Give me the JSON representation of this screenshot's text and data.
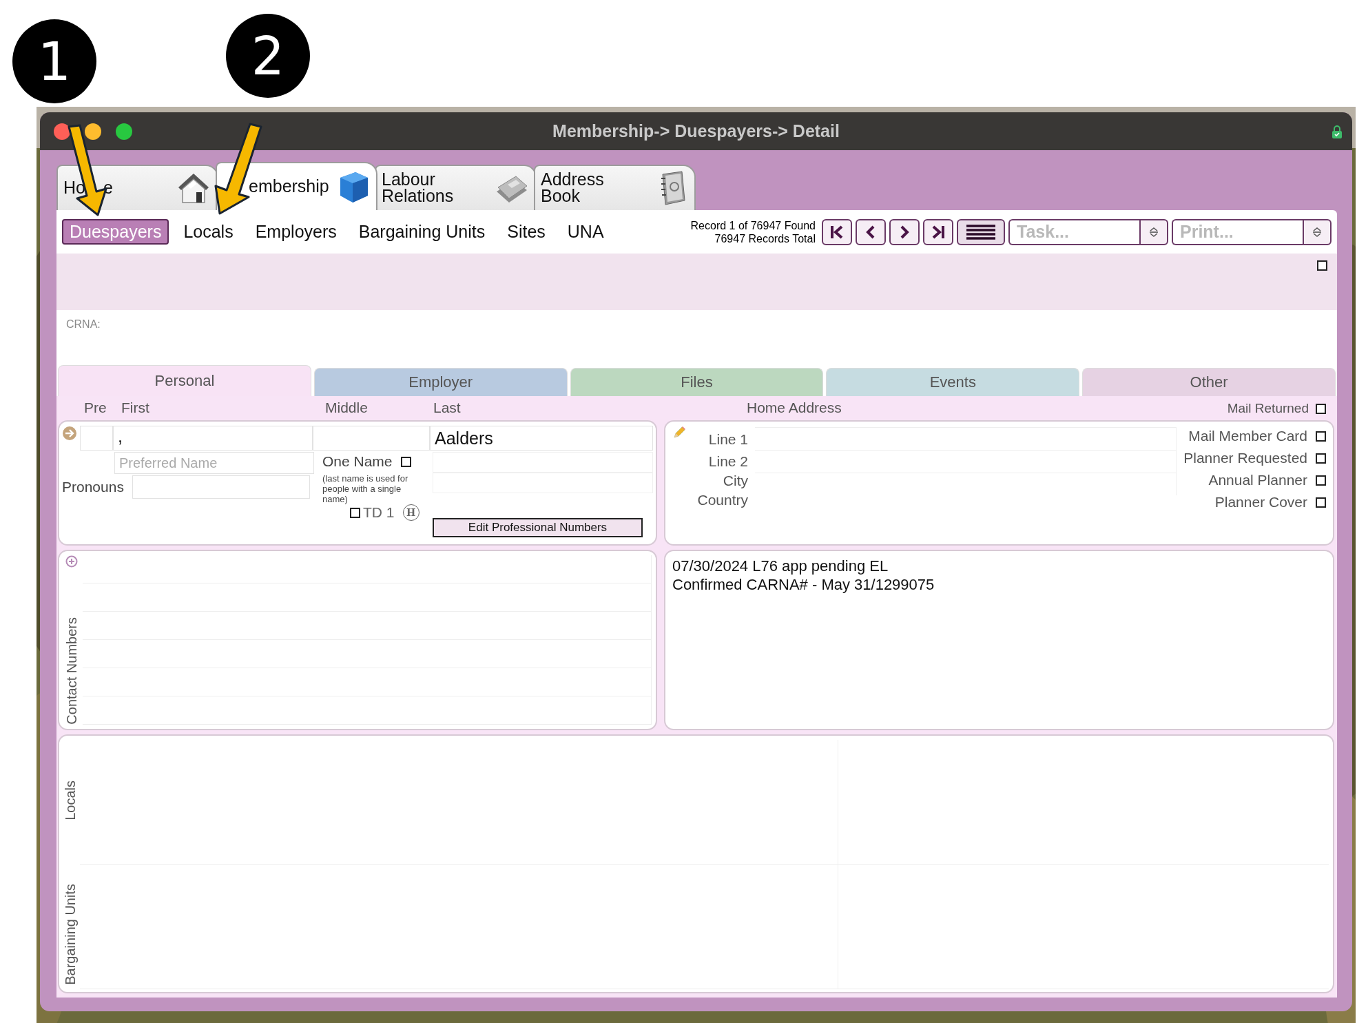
{
  "callouts": [
    "1",
    "2"
  ],
  "window": {
    "title": "Membership-> Duespayers-> Detail"
  },
  "module_tabs": [
    {
      "label_parts": [
        "Ho",
        "e"
      ],
      "kind": "house",
      "selected": false
    },
    {
      "label_parts": [
        "embership"
      ],
      "kind": "cube",
      "selected": true
    },
    {
      "label_parts": [
        "Labour Relations"
      ],
      "kind": "book",
      "selected": false
    },
    {
      "label_parts": [
        "Address Book"
      ],
      "kind": "contacts",
      "selected": false
    }
  ],
  "nav_links": [
    {
      "label": "Duespayers",
      "selected": true
    },
    {
      "label": "Locals",
      "selected": false
    },
    {
      "label": "Employers",
      "selected": false
    },
    {
      "label": "Bargaining Units",
      "selected": false
    },
    {
      "label": "Sites",
      "selected": false
    },
    {
      "label": "UNA",
      "selected": false
    }
  ],
  "record_status": {
    "found": "Record 1 of 76947 Found",
    "total": "76947 Records Total"
  },
  "task_menu": {
    "placeholder": "Task..."
  },
  "print_menu": {
    "placeholder": "Print..."
  },
  "header_checkbox": {
    "checked": false
  },
  "crna_label": "CRNA:",
  "section_tabs": [
    {
      "label": "Personal",
      "selected": true,
      "color": "#f8e3f5"
    },
    {
      "label": "Employer",
      "selected": false,
      "color": "#b8cae0"
    },
    {
      "label": "Files",
      "selected": false,
      "color": "#bcd8bf"
    },
    {
      "label": "Events",
      "selected": false,
      "color": "#c6dce1"
    },
    {
      "label": "Other",
      "selected": false,
      "color": "#e6d2e3"
    }
  ],
  "name_labels": [
    "Pre",
    "First",
    "Middle",
    "Last"
  ],
  "name": {
    "first": ",",
    "last": "Aalders"
  },
  "preferred_name": {
    "placeholder": "Preferred Name"
  },
  "pronouns_label": "Pronouns",
  "one_name": {
    "label": "One Name",
    "checked": false,
    "note": "(last name is used for people with a single name)"
  },
  "td1": {
    "label": "TD 1",
    "checked": false,
    "badge": "H"
  },
  "edit_button": "Edit Professional Numbers",
  "home_address": {
    "title": "Home Address",
    "labels": [
      "Line 1",
      "Line 2",
      "City",
      "Country"
    ]
  },
  "mail_returned": {
    "label": "Mail Returned",
    "checked": false
  },
  "mail_options": [
    {
      "label": "Mail Member Card",
      "checked": false
    },
    {
      "label": "Planner Requested",
      "checked": false
    },
    {
      "label": "Annual Planner",
      "checked": false
    },
    {
      "label": "Planner Cover",
      "checked": false
    }
  ],
  "contact_numbers_label": "Contact Numbers",
  "notes": [
    "07/30/2024 L76 app pending EL",
    "Confirmed CARNA# - May 31/1299075"
  ],
  "locals_label": "Locals",
  "bargaining_units_label": "Bargaining Units"
}
